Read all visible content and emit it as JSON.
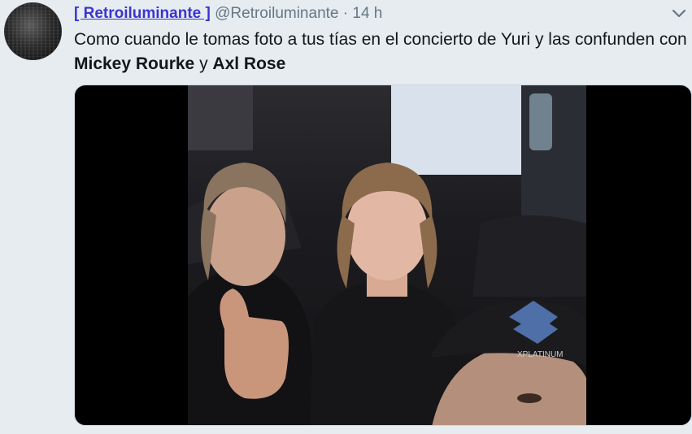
{
  "tweet": {
    "display_name": "[ Retroiluminante ]",
    "handle": "@Retroiluminante",
    "separator": "·",
    "time": "14 h",
    "text_parts": {
      "intro": "Como cuando le tomas foto a tus tías en el concierto de Yuri y las confunden con ",
      "name1": "Mickey Rourke",
      "conj": " y ",
      "name2": "Axl Rose"
    },
    "avatar_icon": "avatar-icon",
    "menu_icon": "chevron-down-icon",
    "photo_logo_text": "XPLATINUM"
  },
  "colors": {
    "background": "#e6ecf0",
    "display_name": "#3b34cf",
    "secondary_text": "#657786",
    "body_text": "#14171a"
  }
}
